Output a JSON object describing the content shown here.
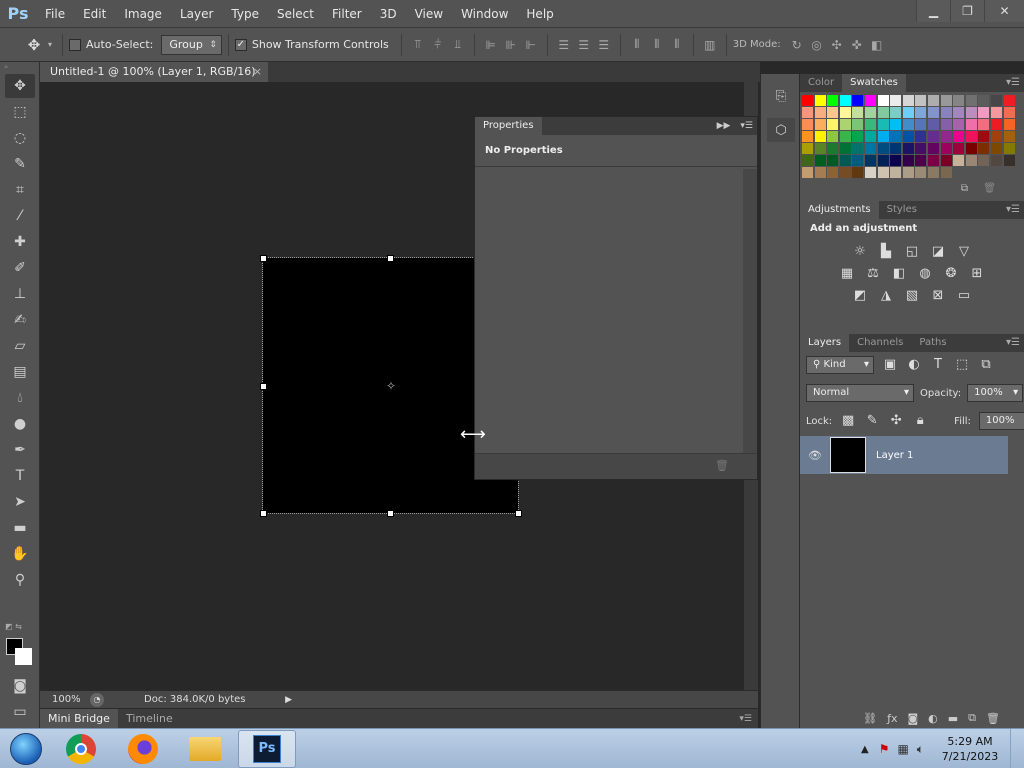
{
  "app": {
    "logo": "Ps"
  },
  "menu": [
    "File",
    "Edit",
    "Image",
    "Layer",
    "Type",
    "Select",
    "Filter",
    "3D",
    "View",
    "Window",
    "Help"
  ],
  "options": {
    "auto_select_label": "Auto-Select:",
    "auto_select_value": "Group",
    "show_transform_label": "Show Transform Controls",
    "mode_3d_label": "3D Mode:"
  },
  "document": {
    "tab_title": "Untitled-1 @ 100% (Layer 1, RGB/16) *",
    "zoom": "100%",
    "doc_info": "Doc: 384.0K/0 bytes"
  },
  "bottom_tabs": [
    "Mini Bridge",
    "Timeline"
  ],
  "properties": {
    "tab": "Properties",
    "body": "No Properties"
  },
  "color_panel": {
    "tabs": [
      "Color",
      "Swatches"
    ]
  },
  "swatches": [
    "#ff0000",
    "#ffff00",
    "#00ff00",
    "#00ffff",
    "#0000ff",
    "#ff00ff",
    "#ffffff",
    "#ebebeb",
    "#d6d6d6",
    "#c2c2c2",
    "#adadad",
    "#999999",
    "#858585",
    "#707070",
    "#5c5c5c",
    "#474747",
    "#ee1d24",
    "#f7977a",
    "#f9ad81",
    "#fdc68a",
    "#fff79a",
    "#c4df9b",
    "#a3d39c",
    "#82ca9d",
    "#7bcdc8",
    "#6ecff6",
    "#7ea7d8",
    "#8493ca",
    "#8882be",
    "#a187be",
    "#bc8dbf",
    "#f49ac2",
    "#f6989d",
    "#f26c4f",
    "#f68e56",
    "#fbaf5d",
    "#fff467",
    "#acd372",
    "#7cc576",
    "#3bb878",
    "#1abbb4",
    "#00bff3",
    "#438cca",
    "#5574b9",
    "#605ca8",
    "#855fa8",
    "#a763a8",
    "#f06ea9",
    "#f26d7d",
    "#ed1c24",
    "#f26522",
    "#f7941d",
    "#fff200",
    "#8dc73f",
    "#39b54a",
    "#00a651",
    "#00a99d",
    "#00aeef",
    "#0072bc",
    "#0054a6",
    "#2e3192",
    "#662d91",
    "#92278f",
    "#ec008c",
    "#ed145b",
    "#9e0b0f",
    "#a0410d",
    "#a36209",
    "#aba000",
    "#598527",
    "#1a7b30",
    "#007236",
    "#00746b",
    "#0076a3",
    "#004b80",
    "#003471",
    "#1b1464",
    "#440e62",
    "#630460",
    "#9e005d",
    "#9e0039",
    "#790000",
    "#7b2e00",
    "#7d4900",
    "#827b00",
    "#406618",
    "#005e20",
    "#005826",
    "#005952",
    "#005b7f",
    "#003663",
    "#002157",
    "#0d004c",
    "#32004b",
    "#4b0049",
    "#7b0046",
    "#7a0026",
    "#c7b299",
    "#998675",
    "#736357",
    "#534741",
    "#372f2a",
    "#c69c6d",
    "#a67c52",
    "#8c6239",
    "#754c24",
    "#603913",
    "#d8d2c4",
    "#cfc3b0",
    "#bfb29e",
    "#ac9d88",
    "#9a8b76",
    "#8a7a64",
    "#79684f"
  ],
  "adjustments": {
    "tabs": [
      "Adjustments",
      "Styles"
    ],
    "heading": "Add an adjustment"
  },
  "layers_panel": {
    "tabs": [
      "Layers",
      "Channels",
      "Paths"
    ],
    "filter_kind": "Kind",
    "blend_mode": "Normal",
    "opacity_label": "Opacity:",
    "opacity_value": "100%",
    "lock_label": "Lock:",
    "fill_label": "Fill:",
    "fill_value": "100%",
    "layers": [
      {
        "name": "Layer 1"
      }
    ]
  },
  "taskbar": {
    "clock_time": "5:29 AM",
    "clock_date": "7/21/2023"
  }
}
